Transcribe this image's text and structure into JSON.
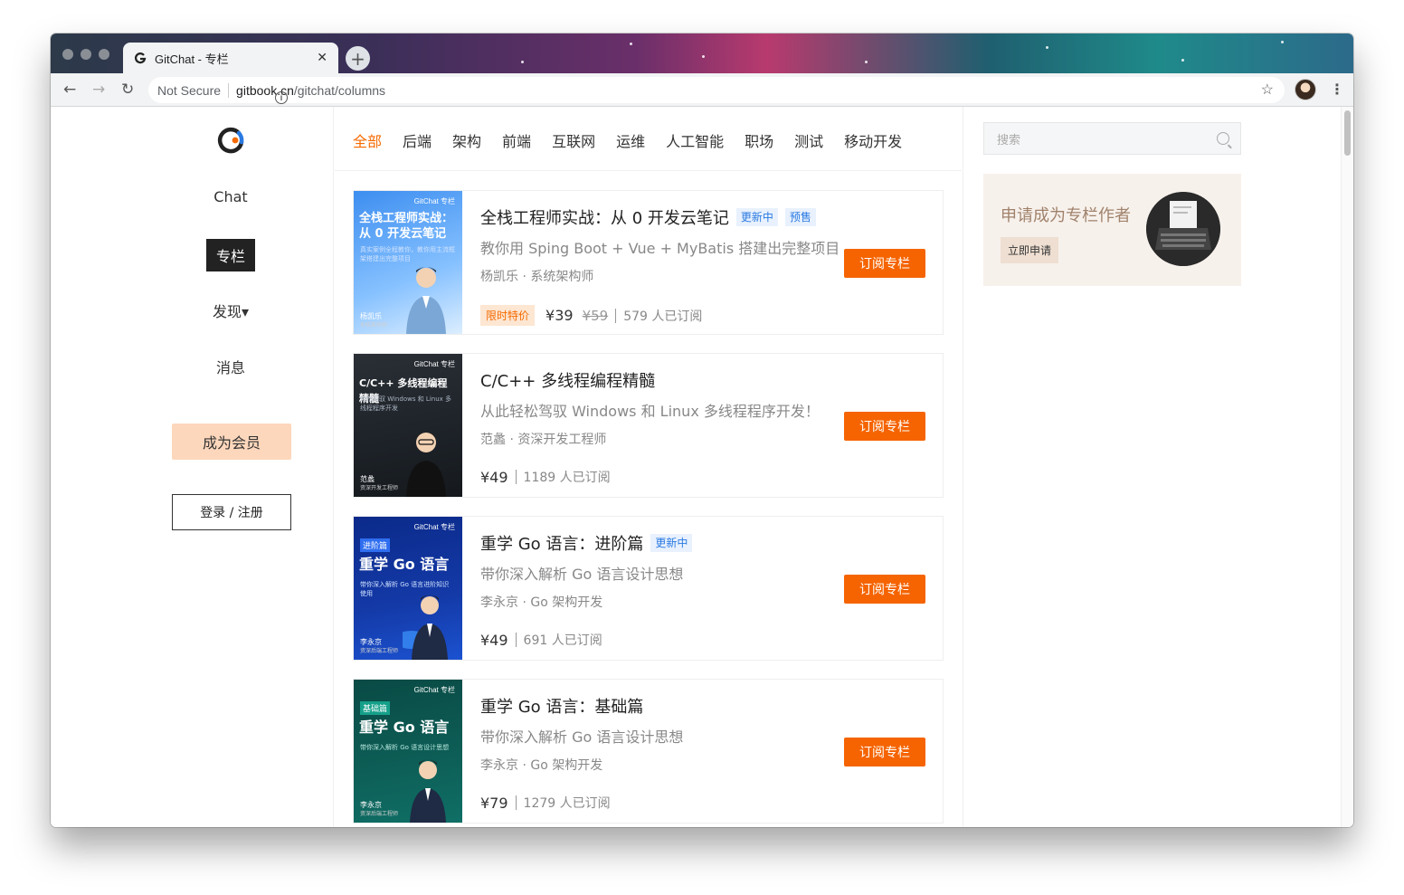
{
  "browser": {
    "tab_title": "GitChat - 专栏",
    "tab_close": "✕",
    "new_tab": "+",
    "security_text": "Not Secure",
    "url_host": "gitbook.cn",
    "url_path": "/gitchat/columns",
    "back": "←",
    "forward": "→",
    "reload": "↻",
    "bookmark": "☆",
    "menu": "⋮"
  },
  "leftnav": {
    "chat": "Chat",
    "columns": "专栏",
    "discover": "发现▾",
    "messages": "消息",
    "vip": "成为会员",
    "login": "登录 / 注册"
  },
  "categories": [
    "全部",
    "后端",
    "架构",
    "前端",
    "互联网",
    "运维",
    "人工智能",
    "职场",
    "测试",
    "移动开发"
  ],
  "cards": [
    {
      "cover_brand": "GitChat 专栏",
      "cover_title": "全栈工程师实战：从 0 开发云笔记",
      "cover_sub": "真实案例全程教你，教你用主流框架搭建出完整项目",
      "cover_author": "杨凯乐",
      "cover_role": "系统架构师",
      "title": "全栈工程师实战：从 0 开发云笔记",
      "badges": [
        "更新中",
        "预售"
      ],
      "desc": "教你用 Sping Boot + Vue + MyBatis 搭建出完整项目",
      "author": "杨凯乐 · 系统架构师",
      "sale_tag": "限时特价",
      "price": "¥39",
      "orig_price": "¥59",
      "subs": "579 人已订阅",
      "button": "订阅专栏"
    },
    {
      "cover_brand": "GitChat 专栏",
      "cover_title": "C/C++ 多线程编程精髓",
      "cover_sub": "轻松驾驭 Windows 和 Linux 多线程程序开发",
      "cover_author": "范蠡",
      "cover_role": "资深开发工程师",
      "title": "C/C++ 多线程编程精髓",
      "badges": [],
      "desc": "从此轻松驾驭 Windows 和 Linux 多线程程序开发！",
      "author": "范蠡 · 资深开发工程师",
      "price": "¥49",
      "subs": "1189 人已订阅",
      "button": "订阅专栏"
    },
    {
      "cover_brand": "GitChat 专栏",
      "cover_tag": "进阶篇",
      "cover_title": "重学 Go 语言",
      "cover_sub": "带你深入解析 Go 语言进阶知识使用",
      "cover_author": "李永京",
      "cover_role": "资深后端工程师",
      "title": "重学 Go 语言：进阶篇",
      "badges": [
        "更新中"
      ],
      "desc": "带你深入解析 Go 语言设计思想",
      "author": "李永京 · Go 架构开发",
      "price": "¥49",
      "subs": "691 人已订阅",
      "button": "订阅专栏"
    },
    {
      "cover_brand": "GitChat 专栏",
      "cover_tag": "基础篇",
      "cover_title": "重学 Go 语言",
      "cover_sub": "带你深入解析 Go 语言设计思想",
      "cover_author": "李永京",
      "cover_role": "资深后端工程师",
      "title": "重学 Go 语言：基础篇",
      "badges": [],
      "desc": "带你深入解析 Go 语言设计思想",
      "author": "李永京 · Go 架构开发",
      "price": "¥79",
      "subs": "1279 人已订阅",
      "button": "订阅专栏"
    }
  ],
  "sidebar": {
    "search_placeholder": "搜索",
    "promo_title": "申请成为专栏作者",
    "promo_button": "立即申请"
  },
  "colors": {
    "accent": "#f56400",
    "active_category": "#f56a00",
    "badge_blue": "#2a7ae2"
  }
}
